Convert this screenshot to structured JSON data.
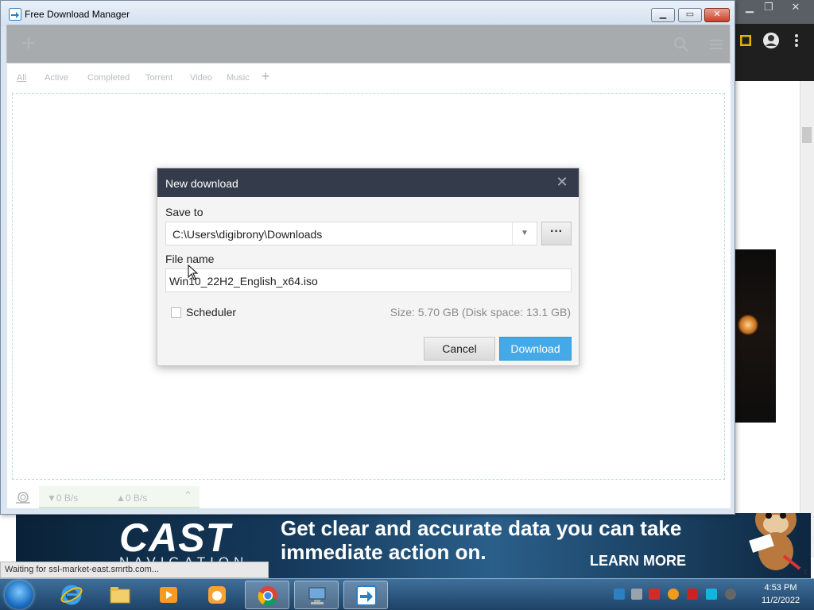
{
  "app": {
    "title": "Free Download Manager"
  },
  "toolbar": {
    "add_glyph": "+"
  },
  "tabs": [
    "All",
    "Active",
    "Completed",
    "Torrent",
    "Video",
    "Music"
  ],
  "tab_add_glyph": "+",
  "bottom_bar": {
    "down_speed": "▼0 B/s",
    "up_speed": "▲0 B/s",
    "toggle_glyph": "⌃"
  },
  "dialog": {
    "title": "New download",
    "close_glyph": "✕",
    "save_to_label": "Save to",
    "save_to_value": "C:\\Users\\digibrony\\Downloads",
    "dropdown_glyph": "▼",
    "browse_label": "···",
    "file_name_label": "File name",
    "file_name_value": "Win10_22H2_English_x64.iso",
    "scheduler_label": "Scheduler",
    "size_info": "Size: 5.70 GB (Disk space: 13.1 GB)",
    "cancel_label": "Cancel",
    "download_label": "Download"
  },
  "ad": {
    "logo": "CAST",
    "logo_sub": "NAVIGATION",
    "headline": "Get clear and accurate data you can take immediate action on.",
    "cta": "LEARN MORE",
    "close_glyph": "x"
  },
  "browser_status": "Waiting for ssl-market-east.smrtb.com...",
  "clock": {
    "time": "4:53 PM",
    "date": "11/2/2022"
  },
  "colors": {
    "accent_blue": "#45a9e8",
    "dialog_header": "#343b4a",
    "taskbar": "#1d4266"
  }
}
